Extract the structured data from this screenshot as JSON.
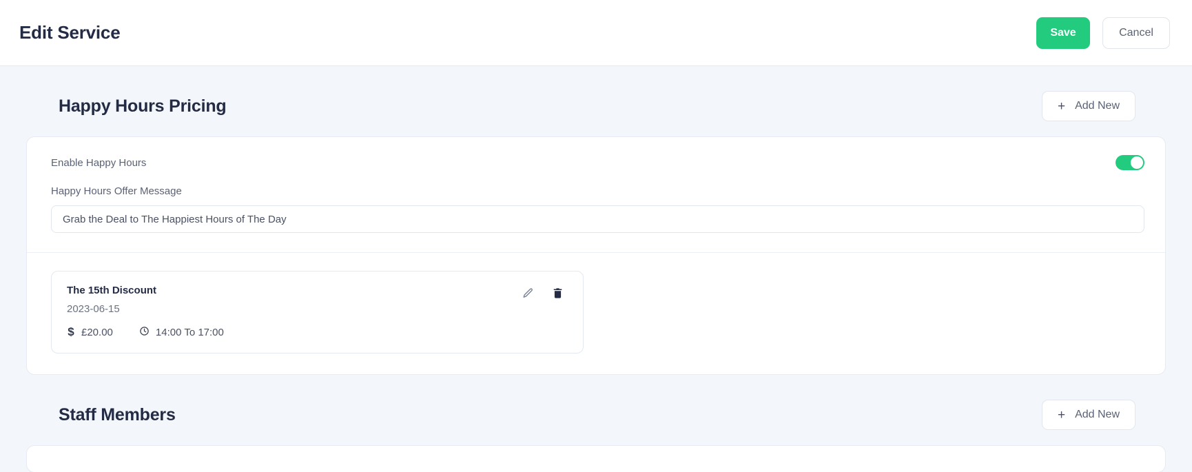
{
  "header": {
    "title": "Edit Service",
    "save_label": "Save",
    "cancel_label": "Cancel",
    "save_color": "#22cb7d"
  },
  "sections": [
    {
      "title": "Happy Hours Pricing",
      "add_new_label": "Add New",
      "add_new_icon": "plus-icon",
      "toggle": {
        "label": "Enable Happy Hours",
        "state": "on",
        "color": "#22cb7d"
      },
      "offer_message": {
        "label": "Happy Hours Offer Message",
        "value": "Grab the Deal to The Happiest Hours of The Day",
        "placeholder": "Happy Hours Offer Message"
      },
      "items": [
        {
          "name": "The 15th Discount",
          "date": "2023-06-15",
          "price_icon": "dollar-icon",
          "price": "£20.00",
          "time_icon": "clock-icon",
          "time_range": "14:00 To 17:00",
          "edit_icon": "pencil-icon",
          "delete_icon": "trash-icon"
        }
      ]
    },
    {
      "title": "Staff Members",
      "add_new_label": "Add New",
      "add_new_icon": "plus-icon"
    }
  ]
}
